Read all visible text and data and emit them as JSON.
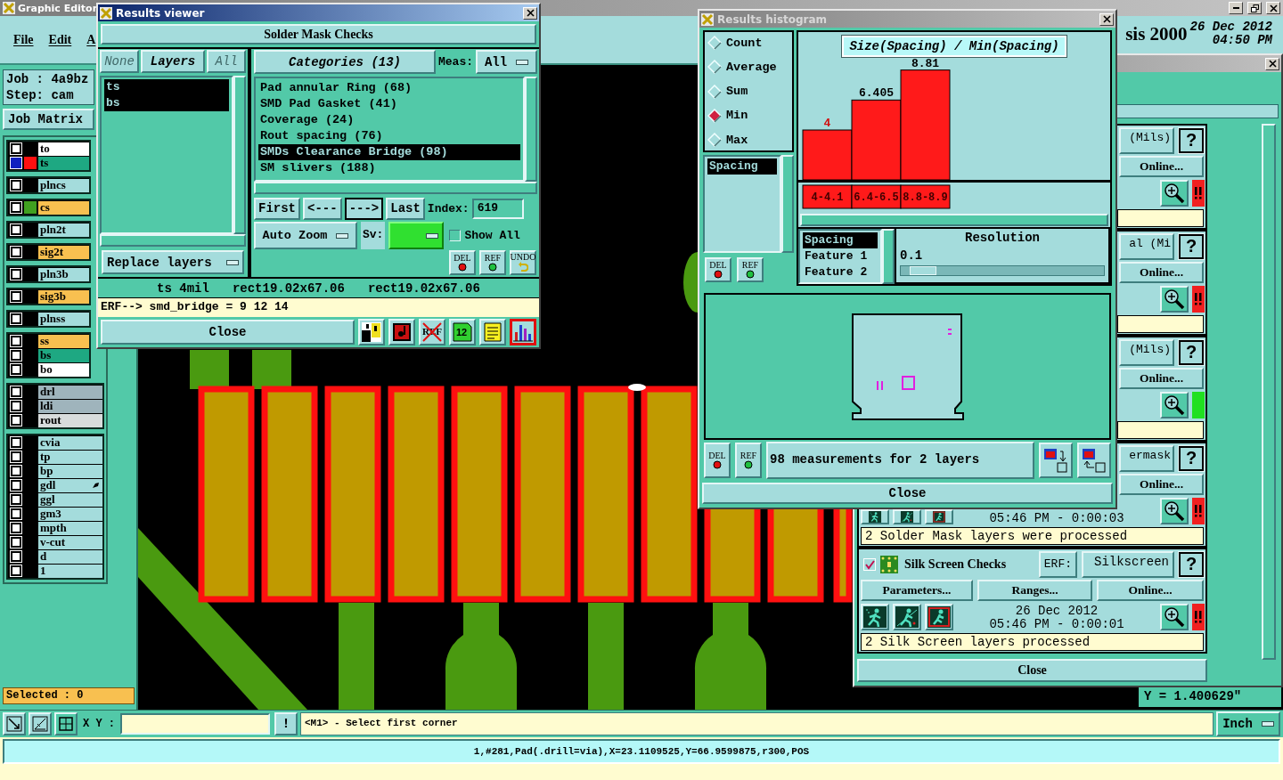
{
  "editor": {
    "title": "Graphic Editor",
    "menu": [
      "File",
      "Edit",
      "A"
    ],
    "app_title": "sis 2000",
    "date": "26 Dec 2012",
    "time": "04:50 PM",
    "job": "Job : 4a9bz",
    "step": "Step: cam",
    "job_matrix": "Job Matrix",
    "layer_groups": [
      {
        "layers": [
          {
            "name": "to",
            "kind": "paste",
            "selected": false,
            "marked": false
          },
          {
            "name": "ts",
            "kind": "mask",
            "color": "#ff1010",
            "selected": true,
            "marked": false
          }
        ]
      },
      {
        "layers": [
          {
            "name": "plncs",
            "kind": "plane",
            "selected": false,
            "marked": false
          }
        ]
      },
      {
        "layers": [
          {
            "name": "cs",
            "kind": "signal",
            "color": "#40a020",
            "selected": false,
            "marked": false
          }
        ]
      },
      {
        "layers": [
          {
            "name": "pln2t",
            "kind": "plane",
            "selected": false,
            "marked": false
          }
        ]
      },
      {
        "layers": [
          {
            "name": "sig2t",
            "kind": "signal",
            "selected": false,
            "marked": false
          }
        ]
      },
      {
        "layers": [
          {
            "name": "pln3b",
            "kind": "plane",
            "selected": false,
            "marked": false
          }
        ]
      },
      {
        "layers": [
          {
            "name": "sig3b",
            "kind": "signal",
            "selected": false,
            "marked": false
          }
        ]
      },
      {
        "layers": [
          {
            "name": "plnss",
            "kind": "plane",
            "selected": false,
            "marked": false
          }
        ]
      },
      {
        "layers": [
          {
            "name": "ss",
            "kind": "silk",
            "selected": false,
            "marked": false
          },
          {
            "name": "bs",
            "kind": "mask",
            "selected": false,
            "marked": false
          },
          {
            "name": "bo",
            "kind": "paste",
            "selected": false,
            "marked": false
          }
        ]
      },
      {
        "layers": [
          {
            "name": "drl",
            "kind": "drill",
            "selected": false,
            "marked": false
          },
          {
            "name": "ldi",
            "kind": "drill",
            "selected": false,
            "marked": false
          },
          {
            "name": "rout",
            "kind": "rout",
            "selected": false,
            "marked": false
          }
        ]
      },
      {
        "layers": [
          {
            "name": "cvia",
            "kind": "document",
            "selected": false,
            "marked": false
          },
          {
            "name": "tp",
            "kind": "document",
            "selected": false,
            "marked": false
          },
          {
            "name": "bp",
            "kind": "document",
            "selected": false,
            "marked": false
          },
          {
            "name": "gdl",
            "kind": "document",
            "selected": false,
            "marked": true
          },
          {
            "name": "ggl",
            "kind": "document",
            "selected": false,
            "marked": false
          },
          {
            "name": "gm3",
            "kind": "document",
            "selected": false,
            "marked": false
          },
          {
            "name": "mpth",
            "kind": "document",
            "selected": false,
            "marked": false
          },
          {
            "name": "v-cut",
            "kind": "document",
            "selected": false,
            "marked": false
          },
          {
            "name": "d",
            "kind": "document",
            "selected": false,
            "marked": false
          },
          {
            "name": "1",
            "kind": "document",
            "selected": false,
            "marked": false
          }
        ]
      }
    ],
    "selected_count": "Selected : 0",
    "y_readout": "Y = 1.400629\"",
    "tools": [
      {
        "kind": "zoom-box",
        "selected": false
      },
      {
        "kind": "measure",
        "selected": false
      },
      {
        "kind": "grid",
        "selected": true
      }
    ],
    "xy_label": "X Y :",
    "prompt_button": "!",
    "prompt": "<M1> - Select first corner",
    "units": "Inch",
    "status_line": "1,#281,Pad(.drill=via),X=23.1109525,Y=66.9599875,r300,POS"
  },
  "results_viewer": {
    "title": "Results viewer",
    "section": "Solder Mask Checks",
    "layer_buttons": [
      {
        "label": "None",
        "kind": "toggle",
        "disabled": true
      },
      {
        "label": "Layers",
        "kind": "title",
        "disabled": false
      },
      {
        "label": "All",
        "kind": "toggle",
        "disabled": true
      }
    ],
    "layers": [
      {
        "name": "ts",
        "selected": true
      },
      {
        "name": "bs",
        "selected": true
      }
    ],
    "replace_mode": "Replace layers",
    "categories_title": "Categories (13)",
    "meas_label": "Meas:",
    "meas_value": "All",
    "categories": [
      {
        "label": "Pad annular Ring (68)",
        "selected": false
      },
      {
        "label": "SMD Pad Gasket (41)",
        "selected": false
      },
      {
        "label": "Coverage (24)",
        "selected": false
      },
      {
        "label": "Rout spacing (76)",
        "selected": false
      },
      {
        "label": "SMDs Clearance Bridge (98)",
        "selected": true
      },
      {
        "label": "SM slivers (188)",
        "selected": false
      }
    ],
    "nav": [
      {
        "label": "First",
        "pressed": false
      },
      {
        "label": "<---",
        "pressed": false
      },
      {
        "label": "--->",
        "pressed": true
      },
      {
        "label": "Last",
        "pressed": false
      }
    ],
    "index_label": "Index:",
    "index_value": "619",
    "zoom_mode": "Auto Zoom",
    "sv_label": "Sv:",
    "show_all": {
      "label": "Show All",
      "checked": false
    },
    "actions": [
      {
        "kind": "del",
        "label": "DEL"
      },
      {
        "kind": "ref",
        "label": "REF"
      },
      {
        "kind": "undo",
        "label": "UNDO"
      }
    ],
    "info": [
      "ts 4mil",
      "rect19.02x67.06",
      "rect19.02x67.06"
    ],
    "erf_line": "ERF--> smd_bridge = 9 12 14",
    "close": "Close",
    "tools": [
      {
        "kind": "figures",
        "selected": false
      },
      {
        "kind": "record",
        "selected": false
      },
      {
        "kind": "ref-cross",
        "label": "REF",
        "selected": false
      },
      {
        "kind": "counter",
        "label": "12",
        "selected": false
      },
      {
        "kind": "notes",
        "selected": false
      },
      {
        "kind": "histogram",
        "selected": true
      }
    ]
  },
  "histogram": {
    "title": "Results histogram",
    "modes": [
      {
        "label": "Count",
        "selected": false
      },
      {
        "label": "Average",
        "selected": false
      },
      {
        "label": "Sum",
        "selected": false
      },
      {
        "label": "Min",
        "selected": true
      },
      {
        "label": "Max",
        "selected": false
      }
    ],
    "fields": [
      {
        "label": "Spacing",
        "selected": true
      }
    ],
    "field_actions": [
      {
        "kind": "del",
        "label": "DEL"
      },
      {
        "kind": "ref",
        "label": "REF"
      }
    ],
    "chart_data": {
      "type": "bar",
      "title": "Size(Spacing) / Min(Spacing)",
      "categories": [
        "4-4.1",
        "6.4-6.5",
        "8.8-8.9"
      ],
      "values": [
        4,
        6.405,
        8.81
      ],
      "data_labels": true
    },
    "columns": [
      {
        "label": "Spacing",
        "selected": true
      },
      {
        "label": "Feature 1",
        "selected": false
      },
      {
        "label": "Feature 2",
        "selected": false
      }
    ],
    "resolution_label": "Resolution",
    "resolution_value": "0.1",
    "resolution": {
      "level": 0.05
    },
    "summary_actions": [
      {
        "kind": "del",
        "label": "DEL"
      },
      {
        "kind": "ref",
        "label": "REF"
      }
    ],
    "summary": "98 measurements for 2 layers",
    "views": [
      {
        "kind": "export"
      },
      {
        "kind": "import"
      }
    ],
    "close": "Close"
  },
  "checks_window": {
    "groups": [
      {
        "field": "(Mils)",
        "help": "?",
        "online": "Online...",
        "color": "#f02020",
        "alert": true
      },
      {
        "field": "al (Mi",
        "help": "?",
        "online": "Online...",
        "color": "#f02020",
        "alert": true
      },
      {
        "field": "(Mils)",
        "help": "?",
        "online": "Online...",
        "color": "#20e020",
        "alert": false
      },
      {
        "field": "ermask",
        "help": "?",
        "online": "Online...",
        "color": "#f02020",
        "alert": true,
        "time": "05:46 PM - 0:00:03",
        "message": "2 Solder Mask layers were processed"
      },
      {
        "checked": true,
        "title": "Silk Screen Checks",
        "erf_label": "ERF:",
        "field": "Silkscreen",
        "help": "?",
        "parameters": "Parameters...",
        "ranges": "Ranges...",
        "online": "Online...",
        "color": "#f02020",
        "alert": true,
        "date": "26 Dec 2012",
        "time": "05:46 PM - 0:00:01",
        "message": "2 Silk Screen layers processed"
      }
    ],
    "close": "Close"
  }
}
